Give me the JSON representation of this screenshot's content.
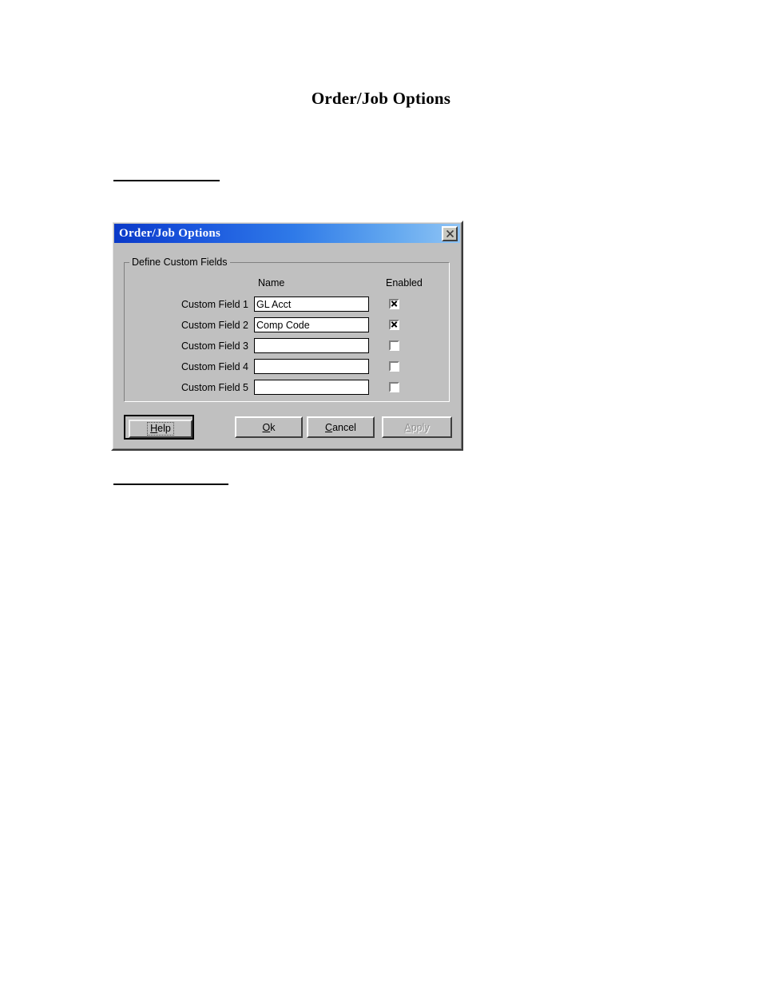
{
  "document": {
    "heading": "Order/Job Options",
    "rules": [
      "",
      ""
    ]
  },
  "dialog": {
    "title": "Order/Job Options",
    "close_icon": "close-icon",
    "groupbox": {
      "legend": "Define Custom Fields",
      "columns": {
        "name": "Name",
        "enabled": "Enabled"
      },
      "rows": [
        {
          "label": "Custom Field 1",
          "value": "GL Acct",
          "enabled": true
        },
        {
          "label": "Custom Field 2",
          "value": "Comp Code",
          "enabled": true
        },
        {
          "label": "Custom Field 3",
          "value": "",
          "enabled": false
        },
        {
          "label": "Custom Field 4",
          "value": "",
          "enabled": false
        },
        {
          "label": "Custom Field 5",
          "value": "",
          "enabled": false
        }
      ]
    },
    "buttons": {
      "help": {
        "label": "Help",
        "accel": "H",
        "default": true,
        "disabled": false
      },
      "ok": {
        "label": "Ok",
        "accel": "O",
        "default": false,
        "disabled": false
      },
      "cancel": {
        "label": "Cancel",
        "accel": "C",
        "default": false,
        "disabled": false
      },
      "apply": {
        "label": "Apply",
        "accel": "A",
        "default": false,
        "disabled": true
      }
    }
  },
  "colors": {
    "dialog_face": "#c0c0c0",
    "titlebar_start": "#0a39c8",
    "titlebar_end": "#8fc4f5",
    "titlebar_text": "#ffffff",
    "field_bg": "#ffffff",
    "disabled_text": "#909090"
  }
}
